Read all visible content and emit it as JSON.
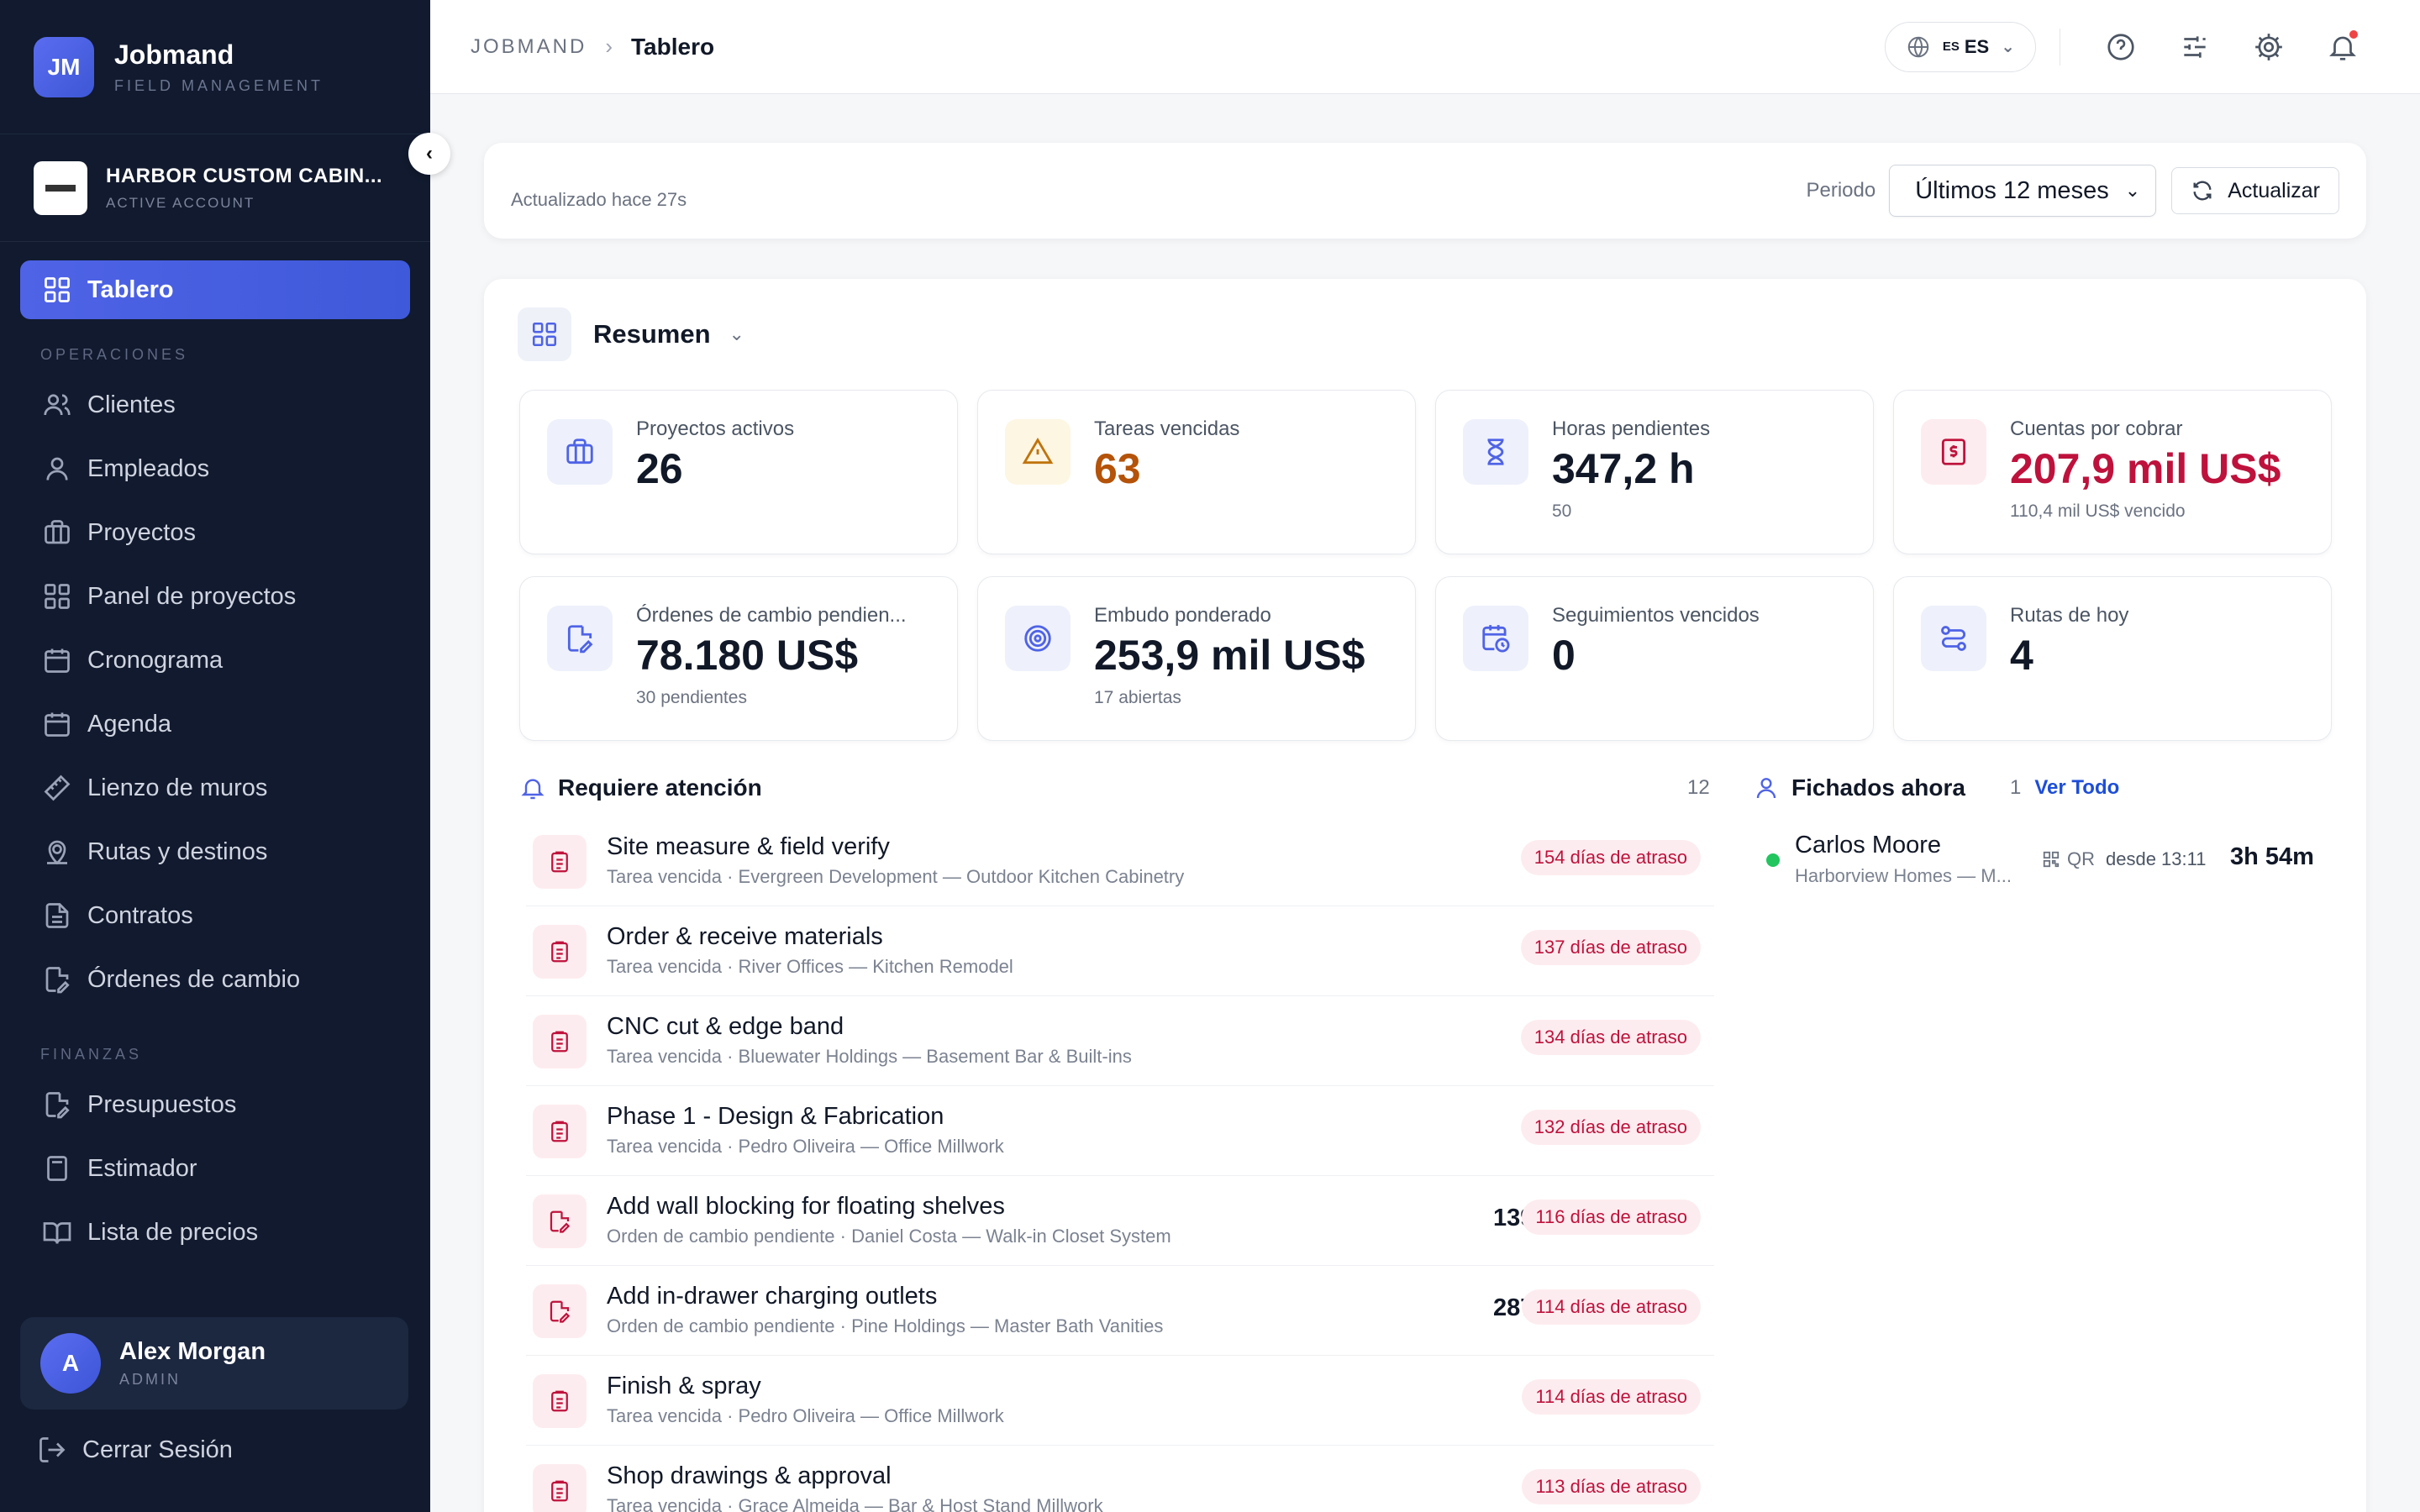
{
  "brand": {
    "initials": "JM",
    "name": "Jobmand",
    "subtitle": "FIELD MANAGEMENT"
  },
  "account": {
    "name": "HARBOR CUSTOM CABIN...",
    "status": "ACTIVE ACCOUNT"
  },
  "sidebar": {
    "active": {
      "label": "Tablero",
      "icon": "dashboard-icon"
    },
    "sections": [
      {
        "title": "OPERACIONES",
        "items": [
          {
            "label": "Clientes",
            "icon": "users-icon"
          },
          {
            "label": "Empleados",
            "icon": "user-icon"
          },
          {
            "label": "Proyectos",
            "icon": "briefcase-icon"
          },
          {
            "label": "Panel de proyectos",
            "icon": "grid-icon"
          },
          {
            "label": "Cronograma",
            "icon": "calendar-icon"
          },
          {
            "label": "Agenda",
            "icon": "calendar-icon"
          },
          {
            "label": "Lienzo de muros",
            "icon": "ruler-icon"
          },
          {
            "label": "Rutas y destinos",
            "icon": "map-pin-icon"
          },
          {
            "label": "Contratos",
            "icon": "file-text-icon"
          },
          {
            "label": "Órdenes de cambio",
            "icon": "file-edit-icon"
          }
        ]
      },
      {
        "title": "FINANZAS",
        "items": [
          {
            "label": "Presupuestos",
            "icon": "file-edit-icon"
          },
          {
            "label": "Estimador",
            "icon": "calculator-icon"
          },
          {
            "label": "Lista de precios",
            "icon": "book-icon"
          }
        ]
      }
    ]
  },
  "user": {
    "initial": "A",
    "name": "Alex Morgan",
    "role": "ADMIN"
  },
  "logout_label": "Cerrar Sesión",
  "breadcrumb": {
    "root": "JOBMAND",
    "current": "Tablero"
  },
  "language": {
    "flag": "ES",
    "code": "ES"
  },
  "toolbar": {
    "updated": "Actualizado hace 27s",
    "period_label": "Periodo",
    "period_value": "Últimos 12 meses",
    "refresh_label": "Actualizar"
  },
  "summary": {
    "title": "Resumen",
    "kpis": [
      {
        "label": "Proyectos activos",
        "value": "26",
        "sub": "",
        "tone": "blue",
        "icon": "briefcase-icon"
      },
      {
        "label": "Tareas vencidas",
        "value": "63",
        "sub": "",
        "tone": "amber",
        "icon": "warning-icon"
      },
      {
        "label": "Horas pendientes",
        "value": "347,2 h",
        "sub": "50",
        "tone": "blue",
        "icon": "hourglass-icon"
      },
      {
        "label": "Cuentas por cobrar",
        "value": "207,9 mil US$",
        "sub": "110,4 mil US$ vencido",
        "tone": "red",
        "icon": "invoice-icon"
      },
      {
        "label": "Órdenes de cambio pendien...",
        "value": "78.180 US$",
        "sub": "30 pendientes",
        "tone": "blue",
        "icon": "file-edit-icon"
      },
      {
        "label": "Embudo ponderado",
        "value": "253,9 mil US$",
        "sub": "17 abiertas",
        "tone": "blue",
        "icon": "target-icon"
      },
      {
        "label": "Seguimientos vencidos",
        "value": "0",
        "sub": "",
        "tone": "blue",
        "icon": "calendar-clock-icon"
      },
      {
        "label": "Rutas de hoy",
        "value": "4",
        "sub": "",
        "tone": "blue",
        "icon": "route-icon"
      }
    ]
  },
  "attention": {
    "title": "Requiere atención",
    "count": "12",
    "items": [
      {
        "title": "Site measure & field verify",
        "sub": "Tarea vencida · Evergreen Development — Outdoor Kitchen Cabinetry",
        "amount": "",
        "badge": "154 días de atraso",
        "kind": "task"
      },
      {
        "title": "Order & receive materials",
        "sub": "Tarea vencida · River Offices — Kitchen Remodel",
        "amount": "",
        "badge": "137 días de atraso",
        "kind": "task"
      },
      {
        "title": "CNC cut & edge band",
        "sub": "Tarea vencida · Bluewater Holdings — Basement Bar & Built-ins",
        "amount": "",
        "badge": "134 días de atraso",
        "kind": "task"
      },
      {
        "title": "Phase 1 - Design & Fabrication",
        "sub": "Tarea vencida · Pedro Oliveira — Office Millwork",
        "amount": "",
        "badge": "132 días de atraso",
        "kind": "task"
      },
      {
        "title": "Add wall blocking for floating shelves",
        "sub": "Orden de cambio pendiente · Daniel Costa — Walk-in Closet System",
        "amount": "1395 US$",
        "badge": "116 días de atraso",
        "kind": "change"
      },
      {
        "title": "Add in-drawer charging outlets",
        "sub": "Orden de cambio pendiente · Pine Holdings — Master Bath Vanities",
        "amount": "2872 US$",
        "badge": "114 días de atraso",
        "kind": "change"
      },
      {
        "title": "Finish & spray",
        "sub": "Tarea vencida · Pedro Oliveira — Office Millwork",
        "amount": "",
        "badge": "114 días de atraso",
        "kind": "task"
      },
      {
        "title": "Shop drawings & approval",
        "sub": "Tarea vencida · Grace Almeida — Bar & Host Stand Millwork",
        "amount": "",
        "badge": "113 días de atraso",
        "kind": "task"
      }
    ]
  },
  "clocked": {
    "title": "Fichados ahora",
    "count": "1",
    "link": "Ver Todo",
    "items": [
      {
        "name": "Carlos Moore",
        "sub": "Harborview Homes — M...",
        "method": "QR",
        "since": "desde 13:11",
        "duration": "3h 54m"
      }
    ]
  },
  "colors": {
    "accent": "#4f63e6",
    "sidebar": "#111a2e",
    "danger": "#be123c",
    "warning": "#b45309",
    "success": "#22c55e"
  }
}
